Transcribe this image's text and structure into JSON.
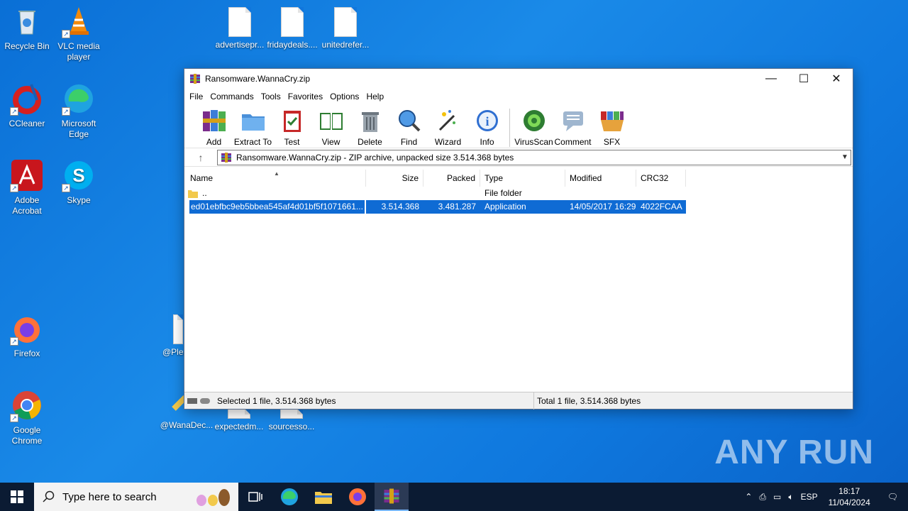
{
  "desktop": {
    "icons": [
      {
        "label": "Recycle Bin"
      },
      {
        "label": "VLC media player"
      },
      {
        "label": "CCleaner"
      },
      {
        "label": "Microsoft Edge"
      },
      {
        "label": "Adobe Acrobat"
      },
      {
        "label": "Skype"
      },
      {
        "label": "Firefox"
      },
      {
        "label": "Google Chrome"
      },
      {
        "label": "advertisepr..."
      },
      {
        "label": "fridaydeals...."
      },
      {
        "label": "unitedrefer..."
      },
      {
        "label": "@Plea"
      },
      {
        "label": "@WanaDec..."
      },
      {
        "label": "expectedm..."
      },
      {
        "label": "sourcesso..."
      }
    ]
  },
  "window": {
    "title": "Ransomware.WannaCry.zip",
    "minimize": "—",
    "maximize": "☐",
    "close": "✕",
    "menu": [
      "File",
      "Commands",
      "Tools",
      "Favorites",
      "Options",
      "Help"
    ],
    "toolbar": [
      "Add",
      "Extract To",
      "Test",
      "View",
      "Delete",
      "Find",
      "Wizard",
      "Info",
      "VirusScan",
      "Comment",
      "SFX"
    ],
    "address": "Ransomware.WannaCry.zip - ZIP archive, unpacked size 3.514.368 bytes",
    "columns": {
      "name": "Name",
      "size": "Size",
      "packed": "Packed",
      "type": "Type",
      "modified": "Modified",
      "crc": "CRC32"
    },
    "rows": [
      {
        "name": "..",
        "size": "",
        "packed": "",
        "type": "File folder",
        "modified": "",
        "crc": ""
      },
      {
        "name": "ed01ebfbc9eb5bbea545af4d01bf5f1071661...",
        "size": "3.514.368",
        "packed": "3.481.287",
        "type": "Application",
        "modified": "14/05/2017 16:29",
        "crc": "4022FCAA"
      }
    ],
    "status_left": "Selected 1 file, 3.514.368 bytes",
    "status_right": "Total 1 file, 3.514.368 bytes"
  },
  "taskbar": {
    "search_placeholder": "Type here to search",
    "lang": "ESP",
    "time": "18:17",
    "date": "11/04/2024"
  },
  "watermark": "ANY RUN"
}
